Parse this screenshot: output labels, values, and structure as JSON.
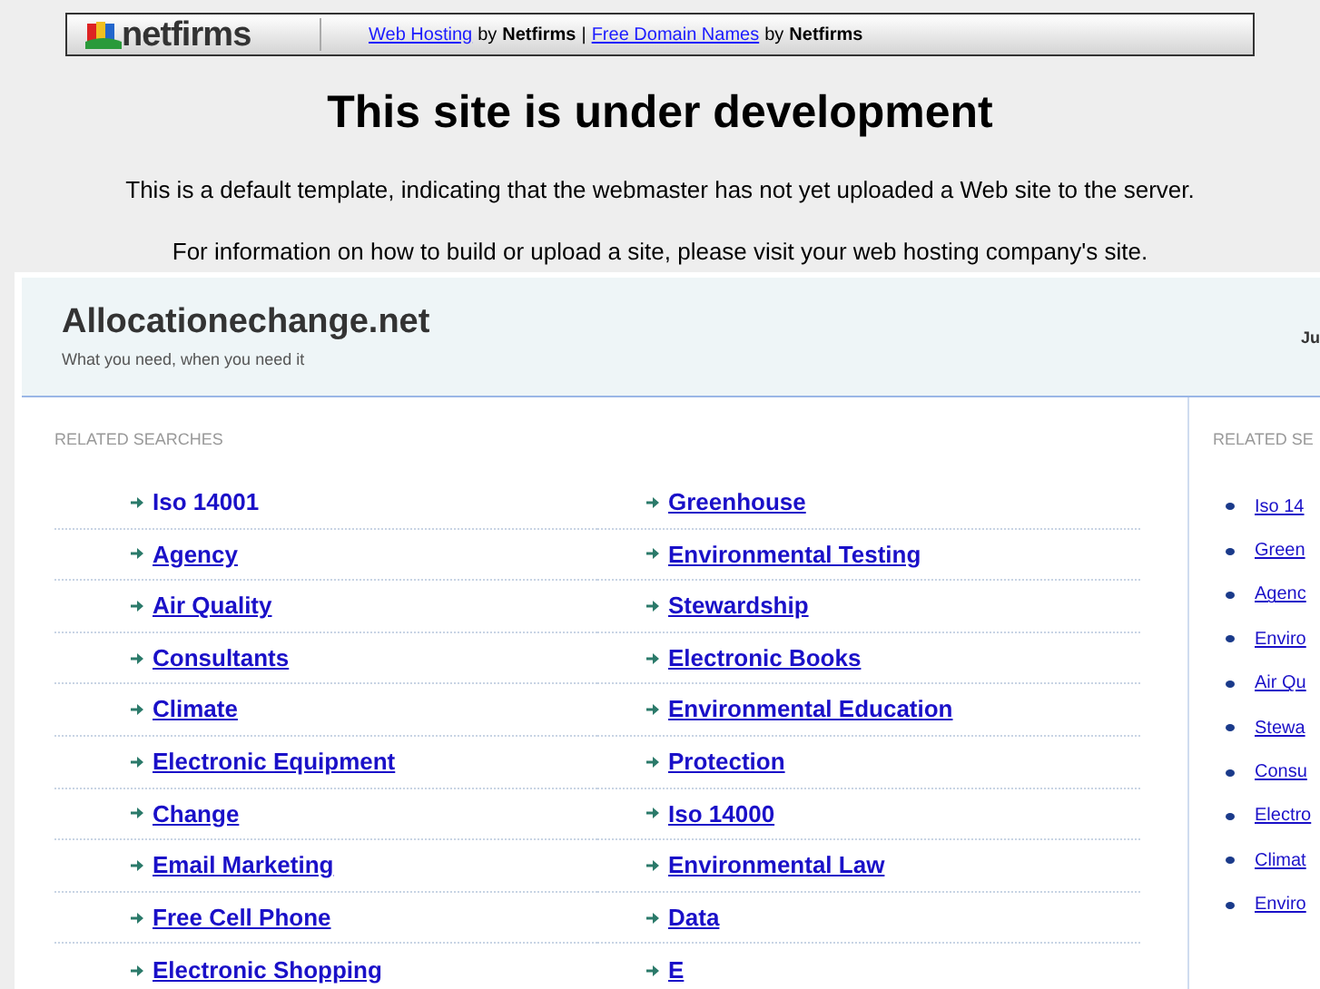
{
  "top_bar": {
    "logo": "netfirms",
    "links": [
      {
        "kind": "link",
        "text": "Web Hosting"
      },
      {
        "kind": "plain",
        "text": "by"
      },
      {
        "kind": "bold",
        "text": "Netfirms"
      },
      {
        "kind": "plain",
        "text": "|"
      },
      {
        "kind": "link",
        "text": "Free Domain Names"
      },
      {
        "kind": "plain",
        "text": "by"
      },
      {
        "kind": "bold",
        "text": "Netfirms"
      }
    ]
  },
  "heading": "This site is under development",
  "paragraphs": [
    "This is a default template, indicating that the webmaster has not yet uploaded a Web site to the server.",
    "For information on how to build or upload a site, please visit your web hosting company's site."
  ],
  "site": {
    "title": "Allocationechange.net",
    "tagline": "What you need, when you need it",
    "header_right": "Ju"
  },
  "main": {
    "heading": "RELATED SEARCHES",
    "links": [
      {
        "text": "Iso 14001",
        "underlined": false
      },
      {
        "text": "Greenhouse",
        "underlined": true
      },
      {
        "text": "Agency",
        "underlined": true
      },
      {
        "text": "Environmental Testing",
        "underlined": true
      },
      {
        "text": "Air Quality",
        "underlined": true
      },
      {
        "text": "Stewardship",
        "underlined": true
      },
      {
        "text": "Consultants",
        "underlined": true
      },
      {
        "text": "Electronic Books",
        "underlined": true
      },
      {
        "text": "Climate",
        "underlined": true
      },
      {
        "text": "Environmental Education",
        "underlined": true
      },
      {
        "text": "Electronic Equipment",
        "underlined": true
      },
      {
        "text": "Protection",
        "underlined": true
      },
      {
        "text": "Change",
        "underlined": true
      },
      {
        "text": "Iso 14000",
        "underlined": true
      },
      {
        "text": "Email Marketing",
        "underlined": true
      },
      {
        "text": "Environmental Law",
        "underlined": true
      },
      {
        "text": "Free Cell Phone",
        "underlined": true
      },
      {
        "text": "Data",
        "underlined": true
      },
      {
        "text": "Electronic Shopping",
        "underlined": true
      },
      {
        "text": "E",
        "underlined": true
      }
    ]
  },
  "sidebar": {
    "heading": "RELATED SE",
    "links": [
      "Iso 14",
      "Green",
      "Agenc",
      "Enviro",
      "Air Qu",
      "Stewa",
      "Consu",
      "Electro",
      "Climat",
      "Enviro"
    ]
  }
}
